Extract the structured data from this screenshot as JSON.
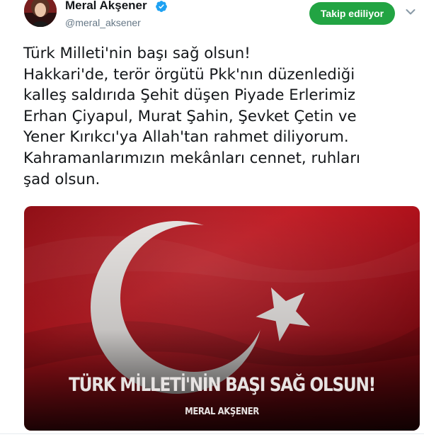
{
  "header": {
    "display_name": "Meral Akşener",
    "handle": "@meral_aksener",
    "verified_icon": "verified-badge-icon",
    "follow_label": "Takip ediliyor",
    "more_icon": "chevron-down-icon"
  },
  "tweet": {
    "text": "Türk Milleti'nin başı sağ olsun!\nHakkari'de, terör örgütü Pkk'nın düzenlediği\nkalleş saldırıda Şehit düşen Piyade Erlerimiz\nErhan Çiyapul, Murat Şahin, Şevket Çetin ve\nYener Kırıkcı'ya Allah'tan rahmet diliyorum.\nKahramanlarımızın mekânları cennet, ruhları\nşad olsun."
  },
  "media": {
    "headline": "TÜRK MİLLETİ'NİN BAŞI SAĞ OLSUN!",
    "signature": "MERAL AKŞENER"
  },
  "colors": {
    "follow_button": "#22a443",
    "verified": "#1da1f2",
    "flag_red": "#b3131b"
  }
}
